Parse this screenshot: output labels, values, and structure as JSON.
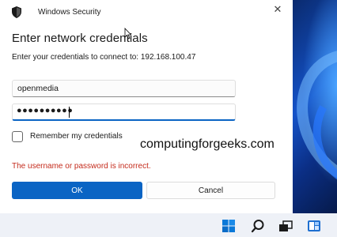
{
  "window": {
    "title": "Windows Security",
    "close_glyph": "✕"
  },
  "dialog": {
    "heading": "Enter network credentials",
    "subtext": "Enter your credentials to connect to: 192.168.100.47",
    "username_value": "openmedia",
    "password_masked": "●●●●●●●●●●",
    "remember_label": "Remember my credentials",
    "remember_checked": false,
    "error_message": "The username or password is incorrect.",
    "ok_label": "OK",
    "cancel_label": "Cancel"
  },
  "watermark": "computingforgeeks.com",
  "taskbar": {
    "icons": [
      "start-icon",
      "search-icon",
      "task-view-icon",
      "widgets-icon"
    ]
  },
  "colors": {
    "accent": "#0a64c4",
    "error": "#c42b1c"
  }
}
